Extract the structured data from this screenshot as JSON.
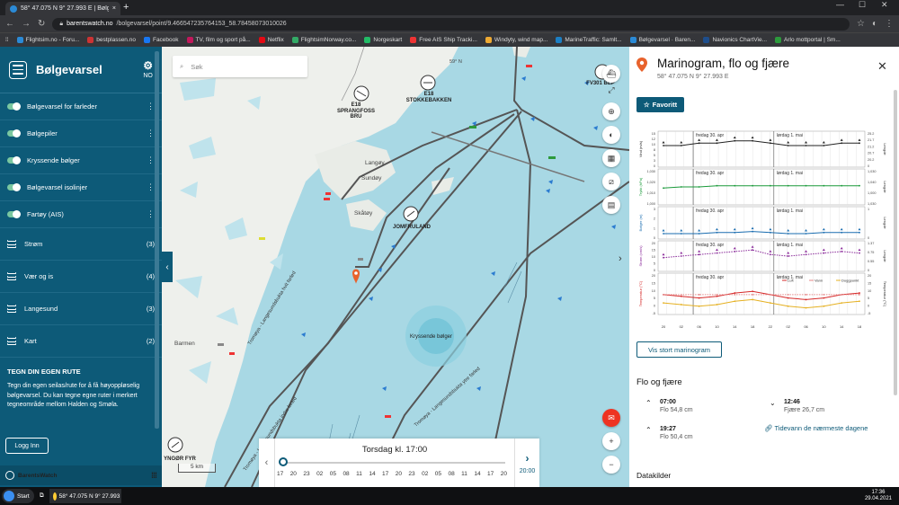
{
  "browser": {
    "tab_title": "58° 47.075 N 9° 27.993 E | Bølge...",
    "url_host": "barentswatch.no",
    "url_path": "/bolgevarsel/point/9.466547235764153_58.78458073010026",
    "bookmarks": [
      "Flightsim.no - Foru...",
      "bestplassen.no",
      "Facebook",
      "TV, film og sport på...",
      "Netflix",
      "FlightsimNorway.co...",
      "Norgeskart",
      "Free AIS Ship Tracki...",
      "Windyty, wind map...",
      "MarineTraffic: Samlt...",
      "Bølgevarsel · Baren...",
      "Navionics ChartVie...",
      "Arlo mottportal | Sm..."
    ]
  },
  "sidebar": {
    "title": "Bølgevarsel",
    "settings_label": "NO",
    "layers": [
      {
        "label": "Bølgevarsel for farleder"
      },
      {
        "label": "Bølgepiler"
      },
      {
        "label": "Kryssende bølger"
      },
      {
        "label": "Bølgevarsel isolinjer"
      },
      {
        "label": "Fartøy (AIS)"
      }
    ],
    "groups": [
      {
        "label": "Strøm",
        "count": "(3)"
      },
      {
        "label": "Vær og is",
        "count": "(4)"
      },
      {
        "label": "Langesund",
        "count": "(3)"
      },
      {
        "label": "Kart",
        "count": "(2)"
      }
    ],
    "route_heading": "TEGN DIN EGEN RUTE",
    "route_text": "Tegn din egen seilas/rute for å få høyoppløselig bølgevarsel. Du kan tegne egne ruter i merkert tegneområde mellom Halden og Smøla.",
    "login_label": "Logg Inn",
    "footer_brand": "BarentsWatch"
  },
  "map": {
    "search_placeholder": "Søk",
    "labels": {
      "e18_sprangfoss": "E18 SPRANGFOSS BRU",
      "e18_stokkebakken": "E18 STOKKEBAKKEN",
      "fv301": "FV301 BEP",
      "jomfruland": "JOMFRULAND",
      "gyngor": "YNGØR FYR",
      "langoy": "Langøy",
      "sundoy": "Sundøy",
      "skaroy": "Skåtøy",
      "barmen": "Barmen",
      "north": "59° N",
      "kryssende": "Kryssende bølger",
      "route1": "Tromøya - Langesundsbukta hvit farled",
      "route2": "Tromøya - Langesundsbukta ytre farled",
      "route3": "Tromøya - Langesundsbukta indre farled"
    },
    "scale": "5 km",
    "timeline": {
      "title": "Torsdag kl. 17:00",
      "hours": [
        "17",
        "20",
        "23",
        "02",
        "05",
        "08",
        "11",
        "14",
        "17",
        "20",
        "23",
        "02",
        "05",
        "08",
        "11",
        "14",
        "17",
        "20"
      ],
      "next_label": "20:00"
    }
  },
  "panel": {
    "title": "Marinogram, flo og fjære",
    "coords": "58° 47.075 N 9° 27.993 E",
    "favorite_label": "Favoritt",
    "big_button": "Vis stort marinogram",
    "tide_heading": "Flo og fjære",
    "tides": [
      {
        "time": "07:00",
        "desc": "Flo 54,8 cm",
        "dir": "up"
      },
      {
        "time": "12:46",
        "desc": "Fjære 26,7 cm",
        "dir": "down"
      },
      {
        "time": "19:27",
        "desc": "Flo 50,4 cm",
        "dir": "up"
      }
    ],
    "tide_link": "Tidevann de nærmeste dagene",
    "data_sources": "Datakilder"
  },
  "chart_data": {
    "type": "line",
    "day_labels": [
      "fredag 30. apr",
      "lørdag 1. mai"
    ],
    "x": [
      "20",
      "02",
      "06",
      "10",
      "14",
      "18",
      "22",
      "02",
      "06",
      "10",
      "14",
      "18"
    ],
    "panels": [
      {
        "ylabel": "Vind (m/s)",
        "ylabel_right": "Lengde",
        "y_ticks": [
          "15",
          "12",
          "10",
          "8",
          "5",
          "3",
          "0"
        ],
        "right_ticks": [
          "25.2",
          "21.7",
          "21.2",
          "20.7",
          "20.2",
          "0"
        ],
        "series": [
          {
            "name": "Vind",
            "color": "#222",
            "values": [
              9,
              9,
              10,
              10,
              11,
              11,
              10,
              9,
              9,
              9,
              10,
              10
            ]
          }
        ]
      },
      {
        "ylabel": "Trykk (hPa)",
        "ylabel_right": "Lengde",
        "y_ticks": [
          "1,030",
          "1,020",
          "1,010",
          "1,000"
        ],
        "right_ticks": [
          "1,030",
          "1,040",
          "1,000",
          "1,030"
        ],
        "series": [
          {
            "name": "Trykk",
            "color": "#1a9a3a",
            "values": [
              1014,
              1015,
              1015,
              1016,
              1016,
              1016,
              1016,
              1016,
              1016,
              1016,
              1016,
              1016
            ]
          }
        ]
      },
      {
        "ylabel": "Bølger (m)",
        "ylabel_right": "Lengde",
        "y_ticks": [
          "3",
          "2",
          "1",
          "0"
        ],
        "right_ticks": [
          "1",
          "0"
        ],
        "series": [
          {
            "name": "Bølger",
            "color": "#1a6db0",
            "values": [
              0.5,
              0.5,
              0.5,
              0.6,
              0.6,
              0.7,
              0.6,
              0.5,
              0.5,
              0.6,
              0.6,
              0.6
            ]
          }
        ]
      },
      {
        "ylabel": "Strøm (cm/s)",
        "ylabel_right": "Lengde",
        "y_ticks": [
          "20",
          "15",
          "10",
          "5",
          "0"
        ],
        "right_ticks": [
          "1.37",
          "0.75",
          "0.55",
          "0"
        ],
        "series": [
          {
            "name": "Strøm",
            "color": "#8a2a9a",
            "values": [
              9,
              10,
              11,
              12,
              13,
              14,
              11,
              10,
              11,
              12,
              13,
              12
            ]
          }
        ]
      },
      {
        "ylabel": "Temperatur (°C)",
        "ylabel_right": "Temperatur (°C)",
        "y_ticks": [
          "20",
          "15",
          "10",
          "5",
          "0",
          "-5"
        ],
        "right_ticks": [
          "20",
          "15",
          "10",
          "5",
          "0",
          "-5"
        ],
        "legend": [
          "Luft",
          "Vann",
          "Duggpunkt"
        ],
        "series": [
          {
            "name": "Luft",
            "color": "#d62a2a",
            "values": [
              7,
              6,
              5,
              6,
              8,
              9,
              7,
              5,
              4,
              5,
              7,
              8
            ]
          },
          {
            "name": "Vann",
            "color": "#e58a8a",
            "values": [
              7,
              7,
              7,
              7,
              7,
              7,
              7,
              7,
              7,
              7,
              7,
              7
            ]
          },
          {
            "name": "Duggpunkt",
            "color": "#e5b021",
            "values": [
              2,
              1,
              0,
              1,
              3,
              4,
              2,
              0,
              -1,
              0,
              2,
              3
            ]
          }
        ]
      }
    ]
  }
}
